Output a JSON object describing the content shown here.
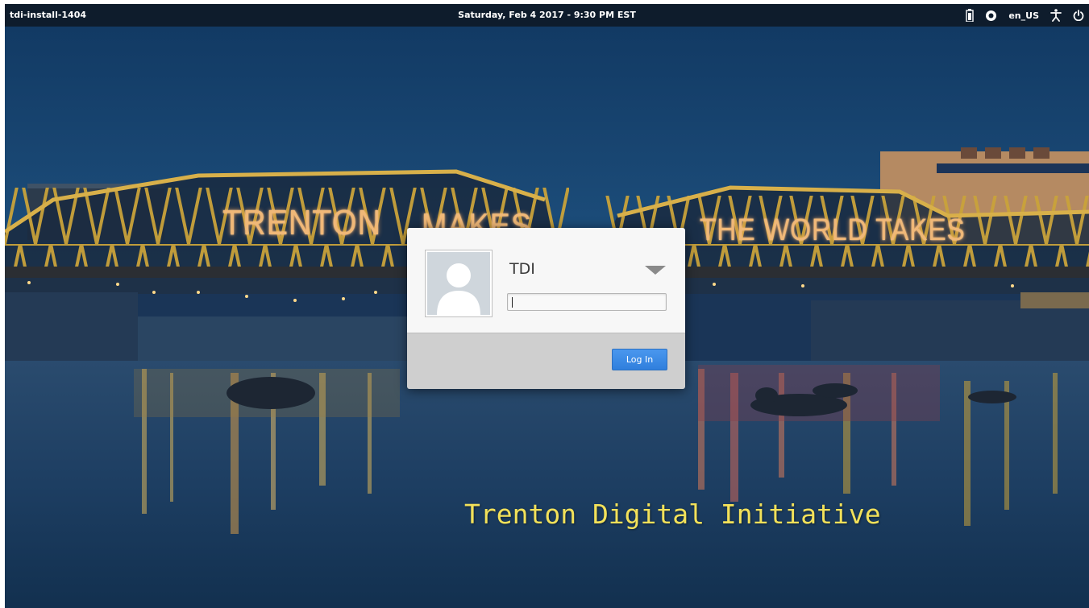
{
  "panel": {
    "hostname": "tdi-install-1404",
    "datetime": "Saturday, Feb 4 2017 - 9:30 PM EST",
    "locale": "en_US"
  },
  "icons": {
    "battery": "battery-icon",
    "session": "session-indicator-icon",
    "accessibility": "accessibility-icon",
    "power": "power-icon",
    "dropdown": "chevron-down-icon",
    "avatar": "user-avatar-icon"
  },
  "wallpaper": {
    "bridge_sign_left": "TRENTON",
    "bridge_sign_mid": "MAKES",
    "bridge_sign_right": "THE WORLD TAKES",
    "caption": "Trenton Digital Initiative"
  },
  "login": {
    "user_name": "TDI",
    "password_value": "",
    "login_button": "Log In"
  },
  "colors": {
    "panel_bg": "#0e1c2c",
    "button_accent": "#3b8ae6",
    "caption_yellow": "#f2e15a",
    "sign_glow": "#f0b878"
  }
}
